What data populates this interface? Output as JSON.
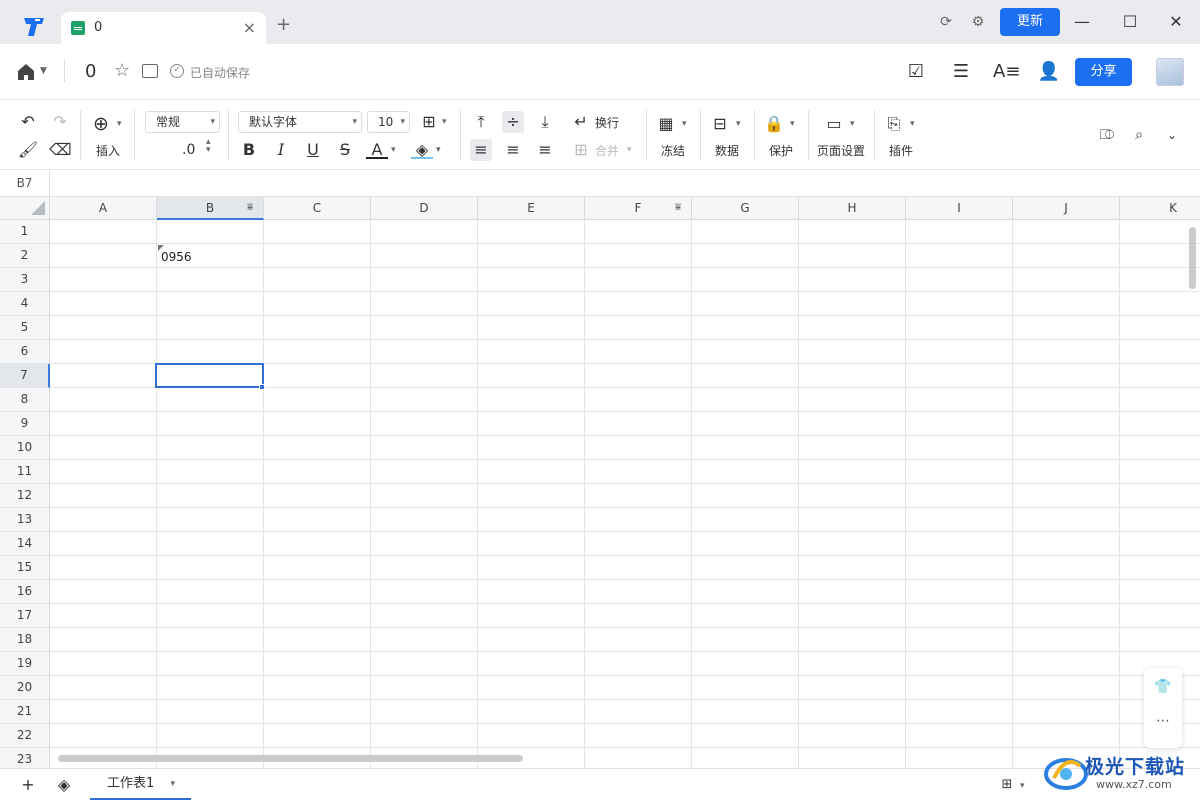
{
  "titlebar": {
    "tab_title": "0",
    "update_label": "更新"
  },
  "docbar": {
    "doc_name": "0",
    "saved_status": "已自动保存",
    "share_label": "分享"
  },
  "toolbar": {
    "insert_label": "插入",
    "number_format": "常规",
    "decimal_label": ".0",
    "font_family": "默认字体",
    "font_size": "10",
    "wrap_label": "换行",
    "merge_label": "合并",
    "freeze_label": "冻结",
    "data_label": "数据",
    "protect_label": "保护",
    "page_setup_label": "页面设置",
    "plugin_label": "插件"
  },
  "formula": {
    "cell_ref": "B7"
  },
  "grid": {
    "columns": [
      "A",
      "B",
      "C",
      "D",
      "E",
      "F",
      "G",
      "H",
      "I",
      "J",
      "K"
    ],
    "rows": [
      "1",
      "2",
      "3",
      "4",
      "5",
      "6",
      "7",
      "8",
      "9",
      "10",
      "11",
      "12",
      "13",
      "14",
      "15",
      "16",
      "17",
      "18",
      "19",
      "20",
      "21",
      "22",
      "23"
    ],
    "selected_column": "B",
    "selected_row": "7",
    "cell_b2": "0956"
  },
  "bottombar": {
    "sheet_name": "工作表1"
  },
  "watermark": {
    "brand": "极光下载站",
    "url": "www.xz7.com"
  },
  "colors": {
    "accent": "#1d6ff2",
    "selection": "#2f6fd6",
    "sheet_icon": "#1fa36a"
  }
}
